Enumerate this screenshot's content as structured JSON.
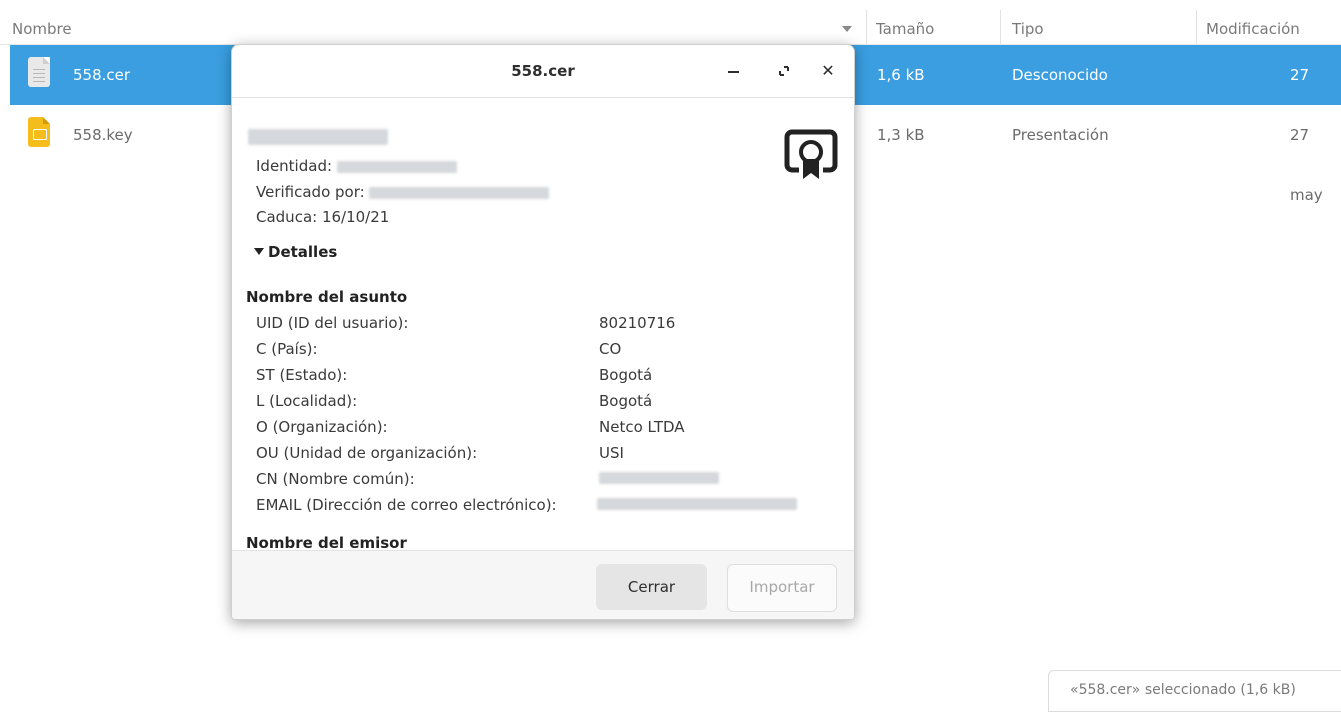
{
  "columns": {
    "name": "Nombre",
    "size": "Tamaño",
    "type": "Tipo",
    "modified": "Modificación"
  },
  "files": [
    {
      "name": "558.cer",
      "size": "1,6 kB",
      "type": "Desconocido",
      "modified": "27 may",
      "icon": "certificate-file-icon"
    },
    {
      "name": "558.key",
      "size": "1,3 kB",
      "type": "Presentación",
      "modified": "27 may",
      "icon": "presentation-file-icon"
    }
  ],
  "status": "«558.cer» seleccionado (1,6 kB)",
  "dialog": {
    "title": "558.cer",
    "identity_label": "Identidad:",
    "verified_label": "Verificado por:",
    "expires_label": "Caduca: 16/10/21",
    "details_label": "Detalles",
    "subject_title": "Nombre del asunto",
    "subject_fields": [
      {
        "label": "UID (ID del usuario):",
        "value": "80210716"
      },
      {
        "label": "C (País):",
        "value": "CO"
      },
      {
        "label": "ST (Estado):",
        "value": "Bogotá"
      },
      {
        "label": "L (Localidad):",
        "value": "Bogotá"
      },
      {
        "label": "O (Organización):",
        "value": "Netco LTDA"
      },
      {
        "label": "OU (Unidad de organización):",
        "value": "USI"
      },
      {
        "label": "CN (Nombre común):",
        "value": ""
      },
      {
        "label": "EMAIL (Dirección de correo electrónico):",
        "value": ""
      }
    ],
    "issuer_title": "Nombre del emisor",
    "close_button": "Cerrar",
    "import_button": "Importar"
  },
  "colors": {
    "selection": "#3a9ee0",
    "key_icon": "#f4bd1c"
  }
}
